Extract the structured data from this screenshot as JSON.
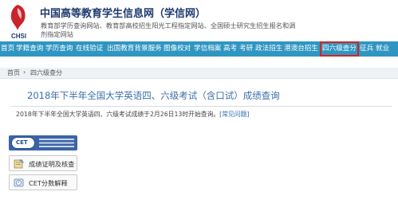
{
  "header": {
    "logo_text": "CHSI",
    "site_title": "中国高等教育学生信息网（学信网）",
    "site_desc": "教育部学历查询网站、教育部高校招生阳光工程指定网站、全国硕士研究生招生报名和调剂指定网站"
  },
  "nav": {
    "items": [
      "首页",
      "学籍查询",
      "学历查询",
      "在线验证",
      "出国教育背景服务",
      "图像校对",
      "学信档案",
      "高考",
      "考研",
      "政法招生",
      "港澳台招生",
      "四六级查分",
      "征兵",
      "就业"
    ],
    "active_index": 11,
    "active_color": "#d9231d",
    "bar_color": "#2f96c2"
  },
  "breadcrumb": {
    "home": "首页",
    "separator": "›",
    "current": "四六级查分"
  },
  "main": {
    "title": "2018年下半年全国大学英语四、六级考试（含口试）成绩查询",
    "notice": "2018年下半年全国大学英语四、六级考试成绩于2月26日13时开始查询。",
    "notice_link": "[常见问题]"
  },
  "sidebar": {
    "cet_logo_text": "CET",
    "buttons": [
      {
        "label": "成绩证明及核查",
        "icon": "certificate-icon"
      },
      {
        "label": "CET分数解释",
        "icon": "help-book-icon"
      }
    ]
  }
}
